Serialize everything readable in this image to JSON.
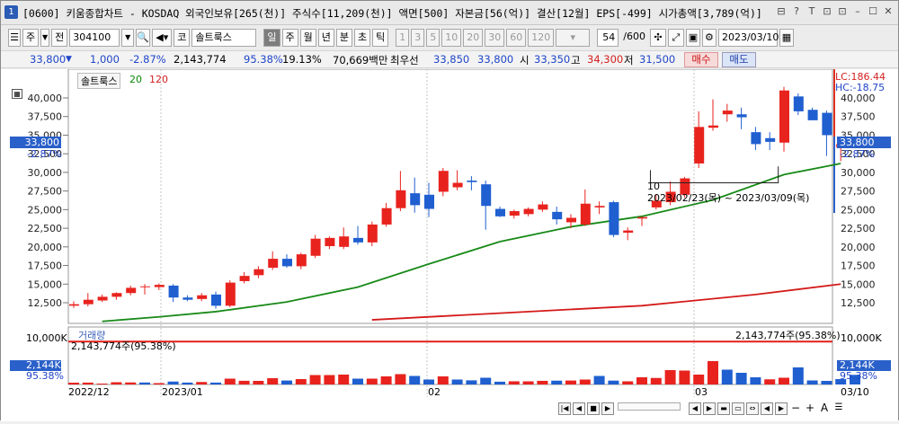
{
  "window": {
    "app_number": "1",
    "title": "[0600] 키움종합차트 - KOSDAQ 외국인보유[265(천)] 주식수[11,209(천)] 액면[500] 자본금[56(억)] 결산[12월] EPS[-499] 시가총액[3,789(억)]",
    "buttons": [
      "⊟",
      "?",
      "T",
      "⊡",
      "⊡",
      "–",
      "☐",
      "✕"
    ]
  },
  "toolbar": {
    "period_type": "주",
    "prev_label": "전",
    "code": "304100",
    "market_tag": "코",
    "stock_name": "솔트룩스",
    "periods": [
      "일",
      "주",
      "월",
      "년",
      "분",
      "초",
      "틱"
    ],
    "selected_period": "일",
    "intervals": [
      "1",
      "3",
      "5",
      "10",
      "20",
      "30",
      "60",
      "120"
    ],
    "count_value": "54",
    "count_total": "/600",
    "date": "2023/03/10"
  },
  "price_row": {
    "price": "33,800",
    "change_arrow": "▼",
    "change": "1,000",
    "change_pct": "-2.87%",
    "volume": "2,143,774",
    "volume_pct": "95.38%",
    "turnover": "19.13%",
    "amount": "70,669백만",
    "best_label": "최우선",
    "best_ask": "33,850",
    "best_bid": "33,800",
    "open_label": "시",
    "open": "33,350",
    "high_label": "고",
    "high": "34,300",
    "low_label": "저",
    "low": "31,500",
    "buy_label": "매수",
    "sell_label": "매도"
  },
  "chart_labels": {
    "legend_name": "솔트룩스",
    "legend_ma1": "20",
    "legend_ma2": "120",
    "lc": "LC:186.44",
    "hc": "HC:-18.75",
    "cur_price_left": "33,800",
    "cur_pct_left": "-2.87%",
    "cur_price_right": "33,800",
    "cur_pct_right": "-2.87%",
    "range_label": "10",
    "range_dates": "2023/02/23(목) ~ 2023/03/09(목)",
    "volume_title": "거래량",
    "volume_value_left": "2,143,774주(95.38%)",
    "volume_value_right": "2,143,774주(95.38%)",
    "vol_axis_top_left": "10,000K",
    "vol_axis_top_right": "10,000K",
    "vol_cur_left": "2,144K",
    "vol_cur_left_pct": "95.38%",
    "vol_cur_right": "2,144K",
    "vol_cur_right_pct": "95.38%",
    "x_labels": [
      "2022/12",
      "2023/01",
      "02",
      "03"
    ],
    "x_end": "03/10"
  },
  "colors": {
    "up": "#e8231e",
    "down": "#1f5fd0",
    "ma20": "#188a18",
    "ma120": "#d41a1a"
  },
  "chart_data": [
    {
      "type": "candlestick",
      "title": "",
      "y_ticks": [
        12500,
        15000,
        17500,
        20000,
        22500,
        25000,
        27500,
        30000,
        32500,
        35000,
        37500,
        40000
      ],
      "ylim": [
        10000,
        42000
      ],
      "candles": [
        {
          "o": 12100,
          "h": 12700,
          "l": 11800,
          "c": 12300
        },
        {
          "o": 12300,
          "h": 13800,
          "l": 12000,
          "c": 12900
        },
        {
          "o": 12800,
          "h": 13600,
          "l": 12600,
          "c": 13300
        },
        {
          "o": 13300,
          "h": 13900,
          "l": 12900,
          "c": 13800
        },
        {
          "o": 13800,
          "h": 14800,
          "l": 13500,
          "c": 14500
        },
        {
          "o": 14600,
          "h": 15000,
          "l": 13600,
          "c": 14700
        },
        {
          "o": 14600,
          "h": 15100,
          "l": 14200,
          "c": 14900
        },
        {
          "o": 14800,
          "h": 15000,
          "l": 12600,
          "c": 13200
        },
        {
          "o": 13200,
          "h": 13500,
          "l": 12700,
          "c": 12900
        },
        {
          "o": 13000,
          "h": 13800,
          "l": 12700,
          "c": 13500
        },
        {
          "o": 13600,
          "h": 14000,
          "l": 11700,
          "c": 12100
        },
        {
          "o": 12100,
          "h": 15500,
          "l": 11900,
          "c": 15200
        },
        {
          "o": 15400,
          "h": 16600,
          "l": 15100,
          "c": 16100
        },
        {
          "o": 16200,
          "h": 17400,
          "l": 15800,
          "c": 17000
        },
        {
          "o": 17200,
          "h": 19400,
          "l": 16900,
          "c": 18400
        },
        {
          "o": 18400,
          "h": 19000,
          "l": 17200,
          "c": 17400
        },
        {
          "o": 17400,
          "h": 19200,
          "l": 17000,
          "c": 19000
        },
        {
          "o": 18800,
          "h": 21600,
          "l": 18500,
          "c": 21100
        },
        {
          "o": 20100,
          "h": 21400,
          "l": 19700,
          "c": 21200
        },
        {
          "o": 20000,
          "h": 22600,
          "l": 19700,
          "c": 21400
        },
        {
          "o": 21200,
          "h": 22800,
          "l": 20300,
          "c": 20600
        },
        {
          "o": 20600,
          "h": 23400,
          "l": 20100,
          "c": 23000
        },
        {
          "o": 23000,
          "h": 25900,
          "l": 22700,
          "c": 25200
        },
        {
          "o": 25200,
          "h": 30200,
          "l": 24800,
          "c": 27600
        },
        {
          "o": 27200,
          "h": 29300,
          "l": 24600,
          "c": 25600
        },
        {
          "o": 27000,
          "h": 28600,
          "l": 24000,
          "c": 25100
        },
        {
          "o": 27400,
          "h": 30600,
          "l": 26800,
          "c": 30200
        },
        {
          "o": 28000,
          "h": 30300,
          "l": 27600,
          "c": 28600
        },
        {
          "o": 28900,
          "h": 29500,
          "l": 27600,
          "c": 28700
        },
        {
          "o": 28400,
          "h": 28900,
          "l": 22300,
          "c": 25500
        },
        {
          "o": 25100,
          "h": 25400,
          "l": 24000,
          "c": 24100
        },
        {
          "o": 24200,
          "h": 25000,
          "l": 23800,
          "c": 24800
        },
        {
          "o": 24400,
          "h": 25300,
          "l": 24100,
          "c": 25100
        },
        {
          "o": 25000,
          "h": 26100,
          "l": 24700,
          "c": 25700
        },
        {
          "o": 24700,
          "h": 25400,
          "l": 23000,
          "c": 23700
        },
        {
          "o": 23300,
          "h": 24400,
          "l": 22500,
          "c": 23900
        },
        {
          "o": 23000,
          "h": 27700,
          "l": 22800,
          "c": 25800
        },
        {
          "o": 25300,
          "h": 26100,
          "l": 24400,
          "c": 25500
        },
        {
          "o": 26000,
          "h": 26200,
          "l": 21300,
          "c": 21600
        },
        {
          "o": 21900,
          "h": 22600,
          "l": 20900,
          "c": 22200
        },
        {
          "o": 23800,
          "h": 24000,
          "l": 22800,
          "c": 24000
        },
        {
          "o": 25300,
          "h": 27000,
          "l": 25000,
          "c": 26200
        },
        {
          "o": 26000,
          "h": 28800,
          "l": 25600,
          "c": 27400
        },
        {
          "o": 27000,
          "h": 29400,
          "l": 26600,
          "c": 29200
        },
        {
          "o": 31200,
          "h": 38200,
          "l": 30600,
          "c": 36100
        },
        {
          "o": 36000,
          "h": 39800,
          "l": 35600,
          "c": 36300
        },
        {
          "o": 37800,
          "h": 39200,
          "l": 36800,
          "c": 38300
        },
        {
          "o": 37800,
          "h": 38700,
          "l": 35800,
          "c": 37400
        },
        {
          "o": 35400,
          "h": 36100,
          "l": 33000,
          "c": 33800
        },
        {
          "o": 34600,
          "h": 35400,
          "l": 33000,
          "c": 34100
        },
        {
          "o": 34000,
          "h": 41500,
          "l": 32800,
          "c": 41000
        },
        {
          "o": 40200,
          "h": 40600,
          "l": 37700,
          "c": 38200
        },
        {
          "o": 38400,
          "h": 38700,
          "l": 37000,
          "c": 37000
        },
        {
          "o": 38000,
          "h": 38300,
          "l": 32200,
          "c": 35000
        },
        {
          "o": 33350,
          "h": 34300,
          "l": 31500,
          "c": 33800
        }
      ],
      "ma20": [
        {
          "i": 2,
          "v": 10000
        },
        {
          "i": 6,
          "v": 10600
        },
        {
          "i": 10,
          "v": 11300
        },
        {
          "i": 15,
          "v": 12600
        },
        {
          "i": 20,
          "v": 14600
        },
        {
          "i": 25,
          "v": 17700
        },
        {
          "i": 30,
          "v": 20700
        },
        {
          "i": 35,
          "v": 22700
        },
        {
          "i": 40,
          "v": 24100
        },
        {
          "i": 45,
          "v": 26300
        },
        {
          "i": 50,
          "v": 29700
        },
        {
          "i": 54,
          "v": 31200
        }
      ],
      "ma120": [
        {
          "i": 21,
          "v": 10200
        },
        {
          "i": 30,
          "v": 11100
        },
        {
          "i": 40,
          "v": 12100
        },
        {
          "i": 48,
          "v": 13600
        },
        {
          "i": 54,
          "v": 15000
        }
      ]
    },
    {
      "type": "bar",
      "title": "",
      "ylim": [
        0,
        10000
      ],
      "unit": "K",
      "values": [
        400,
        420,
        200,
        500,
        450,
        440,
        300,
        650,
        420,
        550,
        420,
        1300,
        820,
        800,
        1400,
        880,
        1200,
        2100,
        2100,
        2200,
        1300,
        1300,
        1800,
        2300,
        1900,
        1100,
        1800,
        1100,
        920,
        1500,
        620,
        710,
        700,
        810,
        850,
        880,
        1100,
        1900,
        860,
        700,
        1600,
        1450,
        3200,
        3100,
        2200,
        5200,
        3300,
        2600,
        1600,
        1150,
        1500,
        3800,
        900,
        800,
        1200,
        2144
      ],
      "up": [
        1,
        1,
        1,
        1,
        1,
        0,
        1,
        0,
        0,
        1,
        0,
        1,
        1,
        1,
        1,
        0,
        1,
        1,
        1,
        1,
        0,
        1,
        1,
        1,
        0,
        0,
        1,
        0,
        0,
        0,
        0,
        1,
        1,
        1,
        0,
        1,
        1,
        0,
        0,
        1,
        1,
        1,
        1,
        1,
        1,
        1,
        0,
        0,
        0,
        1,
        1,
        0,
        0,
        0,
        0,
        0
      ],
      "ref_line": 9538
    }
  ]
}
